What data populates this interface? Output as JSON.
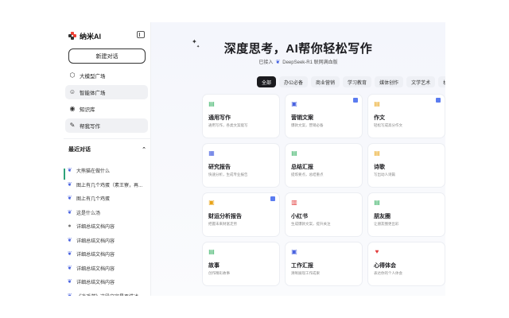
{
  "brand": {
    "name": "纳米AI",
    "logo_colors": [
      "#ef4136",
      "#333333",
      "#ef4136",
      "#333333"
    ]
  },
  "sidebar": {
    "new_chat_label": "新建对话",
    "nav": [
      {
        "label": "大模型广场",
        "icon": "model-square-icon",
        "active": false
      },
      {
        "label": "智能体广场",
        "icon": "agent-square-icon",
        "active": true
      },
      {
        "label": "知识库",
        "icon": "knowledge-base-icon",
        "active": false
      },
      {
        "label": "帮我写作",
        "icon": "writing-icon",
        "active": true
      }
    ],
    "recent_title": "最近对话",
    "recent": [
      {
        "label": "大熊猫在做什么",
        "icon": "deepseek-whale-icon"
      },
      {
        "label": "图上有几个鸡蛋（素王寮，再...",
        "icon": "deepseek-whale-icon"
      },
      {
        "label": "图上有几个鸡蛋",
        "icon": "deepseek-whale-icon"
      },
      {
        "label": "这是什么汤",
        "icon": "deepseek-whale-icon"
      },
      {
        "label": "详细总结文档内容",
        "icon": "person-avatar-icon"
      },
      {
        "label": "详细总结文档内容",
        "icon": "deepseek-whale-icon"
      },
      {
        "label": "详细总结文档内容",
        "icon": "deepseek-whale-icon"
      },
      {
        "label": "详细总结文档内容",
        "icon": "deepseek-whale-icon"
      },
      {
        "label": "详细总结文档内容",
        "icon": "deepseek-whale-icon"
      },
      {
        "label": "《逍遥游》这段文字是否描述...",
        "icon": "deepseek-whale-icon"
      }
    ]
  },
  "hero": {
    "title": "深度思考，AI帮你轻松写作",
    "sub_prefix": "已接入",
    "sub_model": "DeepSeek-R1 联网满血版"
  },
  "categories": [
    {
      "label": "全部",
      "active": true
    },
    {
      "label": "办公必备",
      "active": false
    },
    {
      "label": "商业营销",
      "active": false
    },
    {
      "label": "学习教育",
      "active": false
    },
    {
      "label": "媒体创作",
      "active": false
    },
    {
      "label": "文学艺术",
      "active": false
    },
    {
      "label": "机关公文",
      "active": false
    }
  ],
  "cards": [
    {
      "title": "通用写作",
      "desc": "通用写作，各类文案能写",
      "icon": "document-icon",
      "color": "#2fae5e",
      "badge": false
    },
    {
      "title": "营销文案",
      "desc": "爆款文案，营销必备",
      "icon": "marketing-icon",
      "color": "#4a63e0",
      "badge": true
    },
    {
      "title": "作文",
      "desc": "轻松写成高分作文",
      "icon": "essay-icon",
      "color": "#e8a317",
      "badge": true
    },
    {
      "title": "研究报告",
      "desc": "快速分析，生成专业报告",
      "icon": "report-icon",
      "color": "#4a63e0",
      "badge": false
    },
    {
      "title": "总结汇报",
      "desc": "提炼要点，总结重点",
      "icon": "summary-icon",
      "color": "#2fae5e",
      "badge": false
    },
    {
      "title": "诗歌",
      "desc": "写出动人诗篇",
      "icon": "poem-icon",
      "color": "#e8a317",
      "badge": false
    },
    {
      "title": "财运分析报告",
      "desc": "把握未来财富走势",
      "icon": "finance-icon",
      "color": "#e8a317",
      "badge": true
    },
    {
      "title": "小红书",
      "desc": "生成爆款文案，提升关注",
      "icon": "xiaohongshu-icon",
      "color": "#e23b3b",
      "badge": false
    },
    {
      "title": "朋友圈",
      "desc": "让朋友圈更出彩",
      "icon": "moments-icon",
      "color": "#2fae5e",
      "badge": false
    },
    {
      "title": "故事",
      "desc": "创作精彩故事",
      "icon": "story-icon",
      "color": "#2fae5e",
      "badge": false
    },
    {
      "title": "工作汇报",
      "desc": "清晰展现工作成果",
      "icon": "work-report-icon",
      "color": "#4a63e0",
      "badge": false
    },
    {
      "title": "心得体会",
      "desc": "表达你的个人体会",
      "icon": "reflection-icon",
      "color": "#e23b3b",
      "badge": false
    }
  ]
}
